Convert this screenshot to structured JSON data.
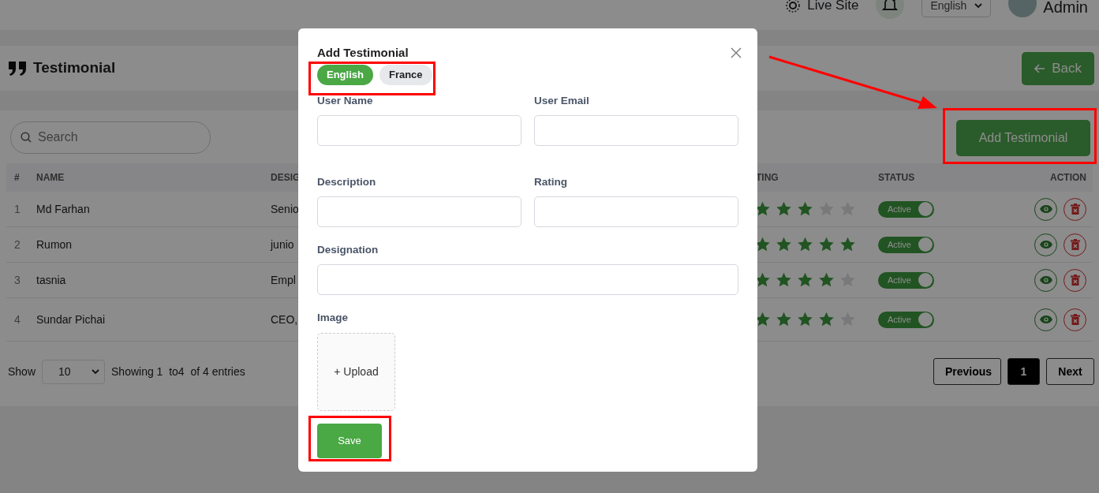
{
  "topbar": {
    "live_site": "Live Site",
    "language": "English",
    "user": "Admin"
  },
  "page_title": "Testimonial",
  "back_button": "Back",
  "search": {
    "placeholder": "Search"
  },
  "add_button": "Add Testimonial",
  "table": {
    "columns": [
      "#",
      "NAME",
      "DESIG",
      "TING",
      "STATUS",
      "ACTION"
    ],
    "rows": [
      {
        "index": "1",
        "name": "Md Farhan",
        "designation": "Senio",
        "stars": 3,
        "status": "Active",
        "active": true
      },
      {
        "index": "2",
        "name": "Rumon",
        "designation": "junio",
        "stars": 5,
        "status": "Active",
        "active": true
      },
      {
        "index": "3",
        "name": "tasnia",
        "designation": "Empl",
        "stars": 4,
        "status": "Active",
        "active": true
      },
      {
        "index": "4",
        "name": "Sundar Pichai",
        "designation": "CEO,",
        "stars": 4,
        "status": "Active",
        "active": true
      }
    ]
  },
  "footer": {
    "show_label": "Show",
    "page_size": "10",
    "info": "Showing 1  to4  of 4 entries",
    "previous": "Previous",
    "pages": [
      {
        "label": "1",
        "selected": true
      }
    ],
    "next": "Next"
  },
  "modal": {
    "title": "Add Testimonial",
    "languages": [
      {
        "label": "English",
        "selected": true
      },
      {
        "label": "France",
        "selected": false
      }
    ],
    "field_rows": [
      [
        {
          "label": "User Name"
        },
        {
          "label": "User Email"
        }
      ],
      [
        {
          "label": "Description"
        },
        {
          "label": "Rating"
        }
      ],
      [
        {
          "label": "Designation"
        }
      ]
    ],
    "image_label": "Image",
    "upload": "+ Upload",
    "save": "Save"
  }
}
